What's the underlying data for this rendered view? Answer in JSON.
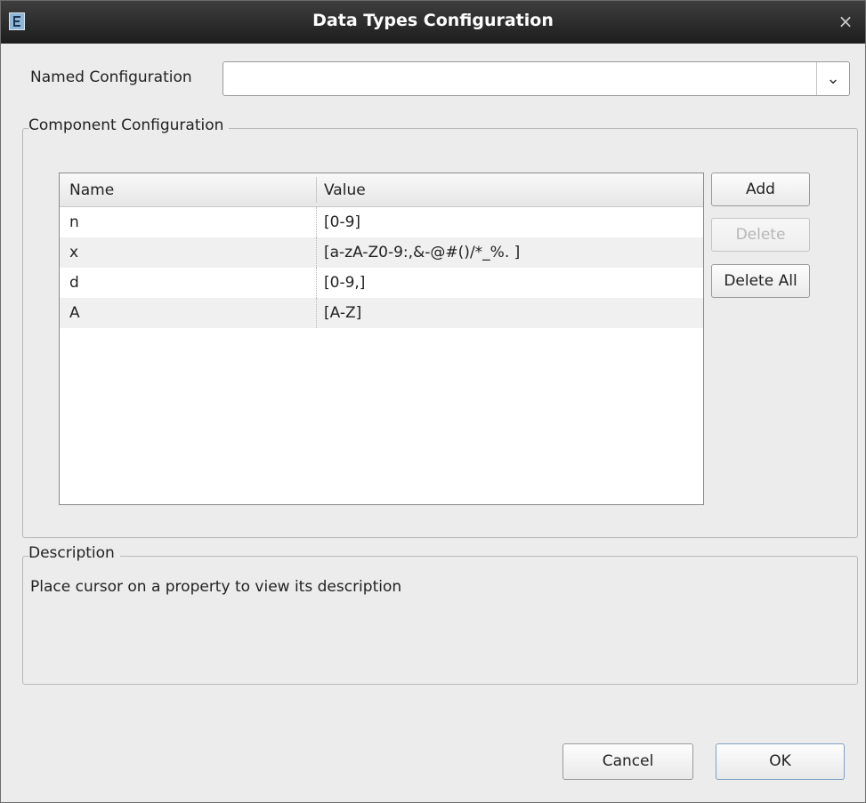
{
  "window": {
    "title": "Data Types Configuration",
    "close_glyph": "×"
  },
  "named_configuration": {
    "label": "Named Configuration",
    "value": "",
    "dropdown_glyph": "⌄"
  },
  "component_configuration": {
    "legend": "Component Configuration",
    "columns": {
      "name": "Name",
      "value": "Value"
    },
    "rows": [
      {
        "name": "n",
        "value": "[0-9]"
      },
      {
        "name": "x",
        "value": "[a-zA-Z0-9:,&-@#()/*_%. ]"
      },
      {
        "name": "d",
        "value": "[0-9,]"
      },
      {
        "name": "A",
        "value": "[A-Z]"
      }
    ],
    "buttons": {
      "add": "Add",
      "delete": "Delete",
      "delete_all": "Delete All"
    }
  },
  "description": {
    "legend": "Description",
    "text": "Place cursor on a property to view its description"
  },
  "footer": {
    "cancel": "Cancel",
    "ok": "OK"
  },
  "icons": {
    "app": "app-icon",
    "close": "close-icon",
    "dropdown": "chevron-down-icon"
  }
}
